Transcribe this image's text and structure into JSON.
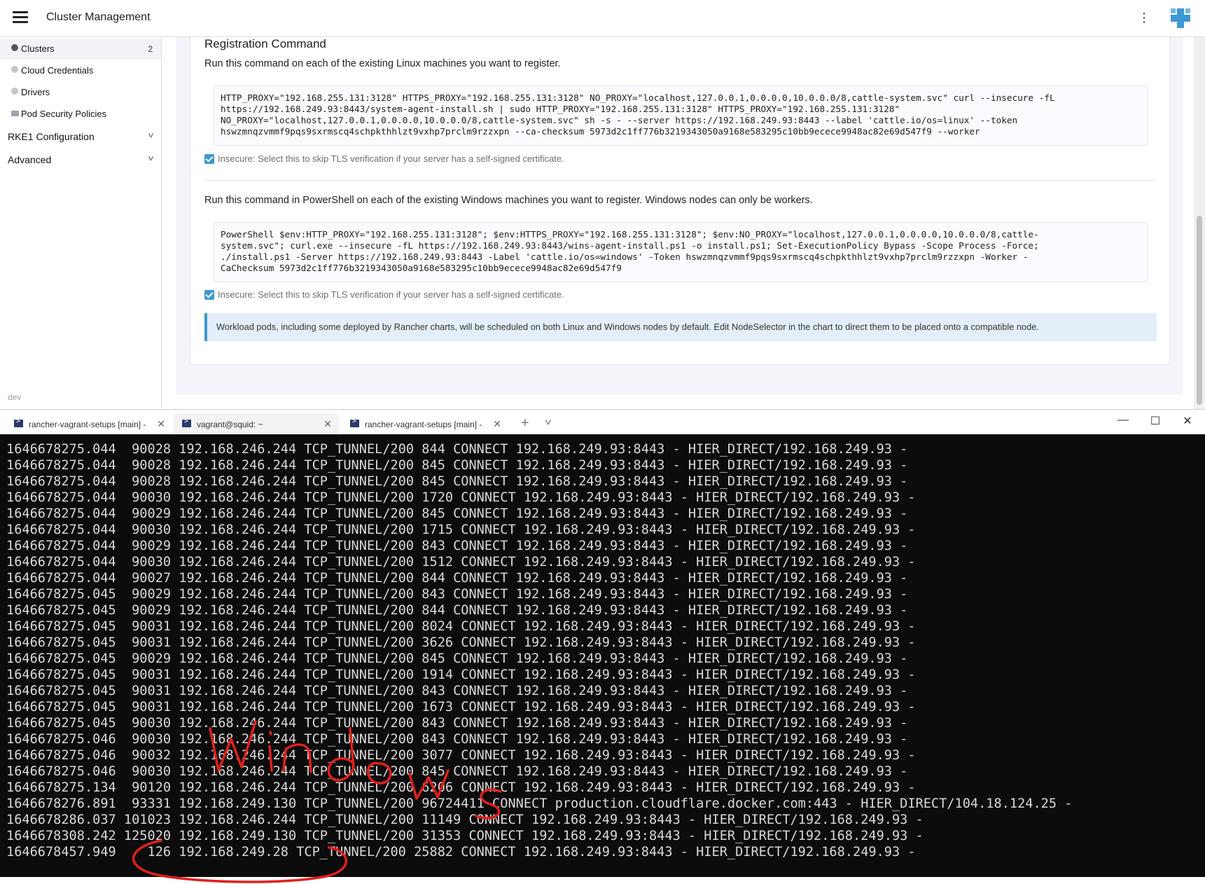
{
  "header": {
    "title": "Cluster Management",
    "menu_icon": "hamburger-icon",
    "more_icon": "kebab-icon",
    "logo": "rancher-logo"
  },
  "sidebar": {
    "items": [
      {
        "label": "Clusters",
        "count": "2",
        "icon": "cluster-icon"
      },
      {
        "label": "Cloud Credentials",
        "icon": "credentials-icon"
      },
      {
        "label": "Drivers",
        "icon": "drivers-icon"
      },
      {
        "label": "Pod Security Policies",
        "icon": "folder-icon"
      }
    ],
    "groups": [
      {
        "label": "RKE1 Configuration"
      },
      {
        "label": "Advanced"
      }
    ],
    "footer": "dev"
  },
  "registration": {
    "title": "Registration Command",
    "linux_instruction": "Run this command on each of the existing Linux machines you want to register.",
    "linux_command": "HTTP_PROXY=\"192.168.255.131:3128\" HTTPS_PROXY=\"192.168.255.131:3128\" NO_PROXY=\"localhost,127.0.0.1,0.0.0.0,10.0.0.0/8,cattle-system.svc\" curl --insecure -fL\nhttps://192.168.249.93:8443/system-agent-install.sh | sudo HTTP_PROXY=\"192.168.255.131:3128\" HTTPS_PROXY=\"192.168.255.131:3128\"\nNO_PROXY=\"localhost,127.0.0.1,0.0.0.0,10.0.0.0/8,cattle-system.svc\" sh -s - --server https://192.168.249.93:8443 --label 'cattle.io/os=linux' --token\nhswzmnqzvmmf9pqs9sxrmscq4schpkthhlzt9vxhp7prclm9rzzxpn --ca-checksum 5973d2c1ff776b3219343050a9168e583295c10bb9ecece9948ac82e69d547f9 --worker",
    "insecure_label": "Insecure: Select this to skip TLS verification if your server has a self-signed certificate.",
    "windows_instruction": "Run this command in PowerShell on each of the existing Windows machines you want to register. Windows nodes can only be workers.",
    "windows_command": "PowerShell $env:HTTP_PROXY=\"192.168.255.131:3128\"; $env:HTTPS_PROXY=\"192.168.255.131:3128\"; $env:NO_PROXY=\"localhost,127.0.0.1,0.0.0.0,10.0.0.0/8,cattle-\nsystem.svc\"; curl.exe --insecure -fL https://192.168.249.93:8443/wins-agent-install.ps1 -o install.ps1; Set-ExecutionPolicy Bypass -Scope Process -Force;\n./install.ps1 -Server https://192.168.249.93:8443 -Label 'cattle.io/os=windows' -Token hswzmnqzvmmf9pqs9sxrmscq4schpkthhlzt9vxhp7prclm9rzzxpn -Worker -\nCaChecksum 5973d2c1ff776b3219343050a9168e583295c10bb9ecece9948ac82e69d547f9",
    "insecure_label_2": "Insecure: Select this to skip TLS verification if your server has a self-signed certificate.",
    "info_banner": "Workload pods, including some deployed by Rancher charts, will be scheduled on both Linux and Windows nodes by default. Edit NodeSelector in the chart to direct them to be placed onto a compatible node."
  },
  "terminal": {
    "tabs": [
      {
        "title": "rancher-vagrant-setups [main] -",
        "active": false
      },
      {
        "title": "vagrant@squid: ~",
        "active": true
      },
      {
        "title": "rancher-vagrant-setups [main] -",
        "active": false
      }
    ],
    "new_tab": "+",
    "dropdown": "v",
    "window_controls": {
      "minimize": "—",
      "maximize": "☐",
      "close": "✕"
    },
    "lines": [
      "1646678275.044  90028 192.168.246.244 TCP_TUNNEL/200 844 CONNECT 192.168.249.93:8443 - HIER_DIRECT/192.168.249.93 -",
      "1646678275.044  90028 192.168.246.244 TCP_TUNNEL/200 845 CONNECT 192.168.249.93:8443 - HIER_DIRECT/192.168.249.93 -",
      "1646678275.044  90028 192.168.246.244 TCP_TUNNEL/200 845 CONNECT 192.168.249.93:8443 - HIER_DIRECT/192.168.249.93 -",
      "1646678275.044  90030 192.168.246.244 TCP_TUNNEL/200 1720 CONNECT 192.168.249.93:8443 - HIER_DIRECT/192.168.249.93 -",
      "1646678275.044  90029 192.168.246.244 TCP_TUNNEL/200 845 CONNECT 192.168.249.93:8443 - HIER_DIRECT/192.168.249.93 -",
      "1646678275.044  90030 192.168.246.244 TCP_TUNNEL/200 1715 CONNECT 192.168.249.93:8443 - HIER_DIRECT/192.168.249.93 -",
      "1646678275.044  90029 192.168.246.244 TCP_TUNNEL/200 843 CONNECT 192.168.249.93:8443 - HIER_DIRECT/192.168.249.93 -",
      "1646678275.044  90030 192.168.246.244 TCP_TUNNEL/200 1512 CONNECT 192.168.249.93:8443 - HIER_DIRECT/192.168.249.93 -",
      "1646678275.044  90027 192.168.246.244 TCP_TUNNEL/200 844 CONNECT 192.168.249.93:8443 - HIER_DIRECT/192.168.249.93 -",
      "1646678275.045  90029 192.168.246.244 TCP_TUNNEL/200 843 CONNECT 192.168.249.93:8443 - HIER_DIRECT/192.168.249.93 -",
      "1646678275.045  90029 192.168.246.244 TCP_TUNNEL/200 844 CONNECT 192.168.249.93:8443 - HIER_DIRECT/192.168.249.93 -",
      "1646678275.045  90031 192.168.246.244 TCP_TUNNEL/200 8024 CONNECT 192.168.249.93:8443 - HIER_DIRECT/192.168.249.93 -",
      "1646678275.045  90031 192.168.246.244 TCP_TUNNEL/200 3626 CONNECT 192.168.249.93:8443 - HIER_DIRECT/192.168.249.93 -",
      "1646678275.045  90029 192.168.246.244 TCP_TUNNEL/200 845 CONNECT 192.168.249.93:8443 - HIER_DIRECT/192.168.249.93 -",
      "1646678275.045  90031 192.168.246.244 TCP_TUNNEL/200 1914 CONNECT 192.168.249.93:8443 - HIER_DIRECT/192.168.249.93 -",
      "1646678275.045  90031 192.168.246.244 TCP_TUNNEL/200 843 CONNECT 192.168.249.93:8443 - HIER_DIRECT/192.168.249.93 -",
      "1646678275.045  90031 192.168.246.244 TCP_TUNNEL/200 1673 CONNECT 192.168.249.93:8443 - HIER_DIRECT/192.168.249.93 -",
      "1646678275.045  90030 192.168.246.244 TCP_TUNNEL/200 843 CONNECT 192.168.249.93:8443 - HIER_DIRECT/192.168.249.93 -",
      "1646678275.046  90030 192.168.246.244 TCP_TUNNEL/200 843 CONNECT 192.168.249.93:8443 - HIER_DIRECT/192.168.249.93 -",
      "1646678275.046  90032 192.168.246.244 TCP_TUNNEL/200 3077 CONNECT 192.168.249.93:8443 - HIER_DIRECT/192.168.249.93 -",
      "1646678275.046  90030 192.168.246.244 TCP_TUNNEL/200 845 CONNECT 192.168.249.93:8443 - HIER_DIRECT/192.168.249.93 -",
      "1646678275.134  90120 192.168.246.244 TCP_TUNNEL/200 6206 CONNECT 192.168.249.93:8443 - HIER_DIRECT/192.168.249.93 -",
      "1646678276.891  93331 192.168.249.130 TCP_TUNNEL/200 96724411 CONNECT production.cloudflare.docker.com:443 - HIER_DIRECT/104.18.124.25 -",
      "1646678286.037 101023 192.168.246.244 TCP_TUNNEL/200 11149 CONNECT 192.168.249.93:8443 - HIER_DIRECT/192.168.249.93 -",
      "1646678308.242 125020 192.168.249.130 TCP_TUNNEL/200 31353 CONNECT 192.168.249.93:8443 - HIER_DIRECT/192.168.249.93 -",
      "1646678457.949    126 192.168.249.28 TCP_TUNNEL/200 25882 CONNECT 192.168.249.93:8443 - HIER_DIRECT/192.168.249.93 -"
    ]
  },
  "annotation": {
    "handwritten_text": "windows",
    "color": "#e0201b"
  },
  "colors": {
    "accent": "#3d98d3",
    "terminal_bg": "#0c0c0c",
    "terminal_fg": "#d9d9d9",
    "info_bg": "#e4eef9"
  }
}
